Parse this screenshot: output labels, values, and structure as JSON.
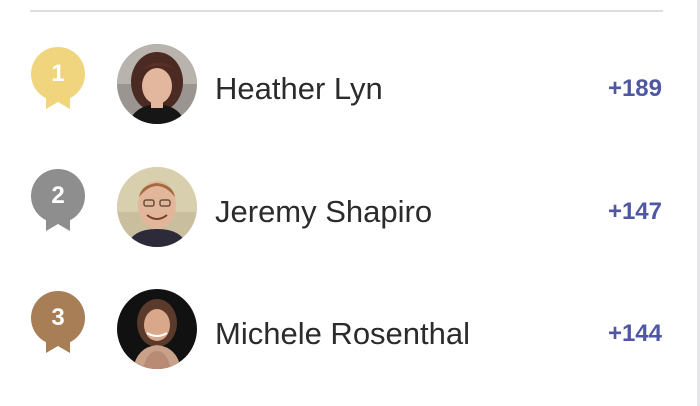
{
  "colors": {
    "gold": "#f0d57e",
    "silver": "#8e8e8e",
    "bronze": "#a77e55",
    "score": "#4f57a3",
    "name": "#2b2b2b",
    "divider": "#dddddf"
  },
  "leaderboard": {
    "entries": [
      {
        "rank": "1",
        "badge": "gold-ribbon-icon",
        "avatar": "avatar-heather-lyn",
        "name": "Heather Lyn",
        "score": "+189"
      },
      {
        "rank": "2",
        "badge": "silver-ribbon-icon",
        "avatar": "avatar-jeremy-shapiro",
        "name": "Jeremy Shapiro",
        "score": "+147"
      },
      {
        "rank": "3",
        "badge": "bronze-ribbon-icon",
        "avatar": "avatar-michele-rosenthal",
        "name": "Michele Rosenthal",
        "score": "+144"
      }
    ]
  }
}
